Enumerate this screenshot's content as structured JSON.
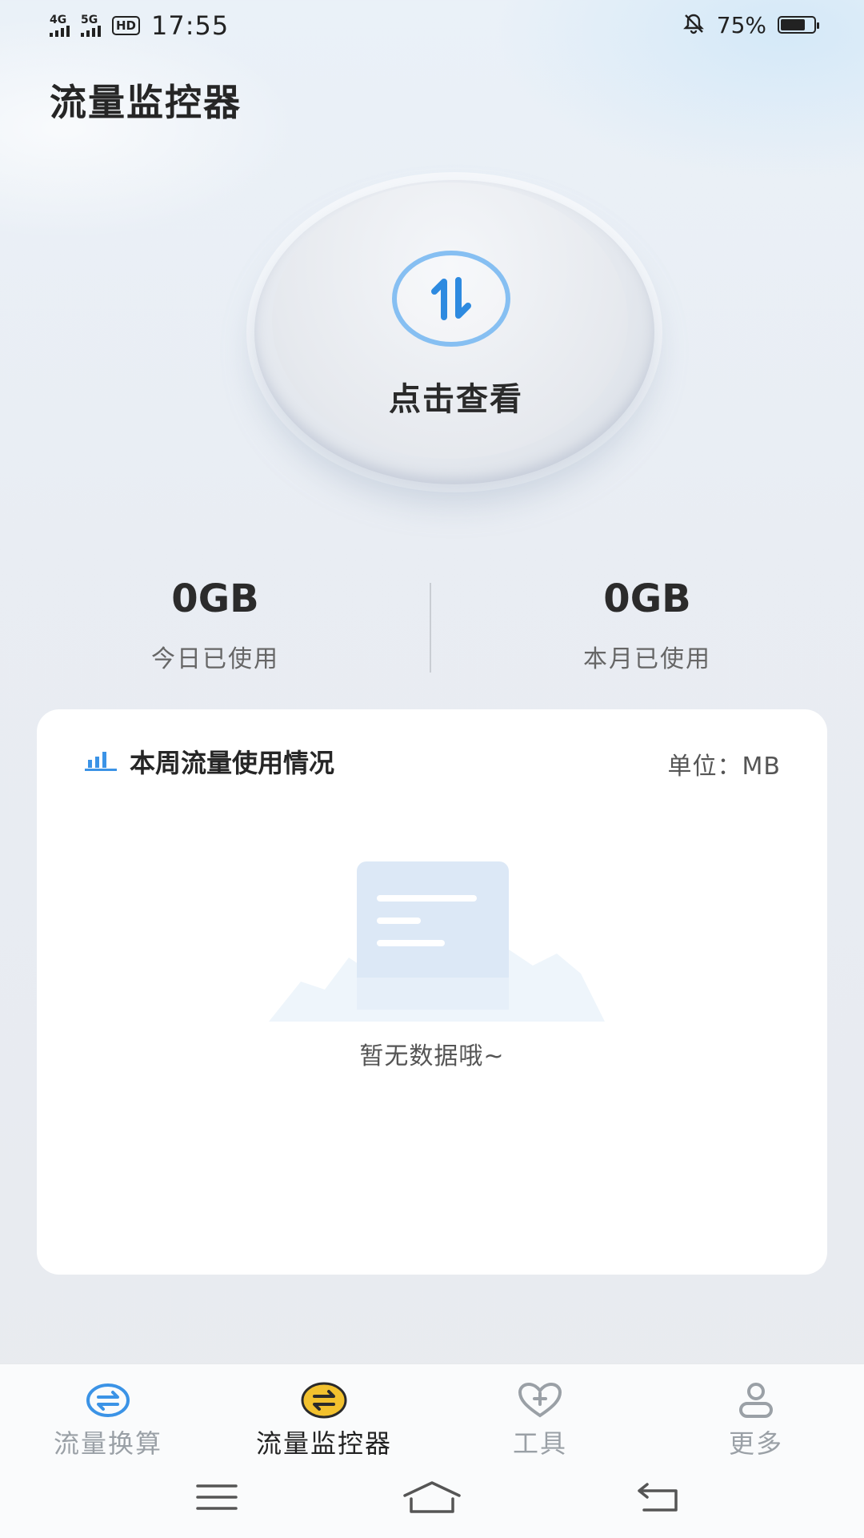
{
  "status_bar": {
    "net1": "4G",
    "net2": "5G",
    "hd": "HD",
    "time": "17:55",
    "battery_pct": "75%",
    "battery_level": 0.75
  },
  "app": {
    "title": "流量监控器"
  },
  "dial": {
    "label": "点击查看",
    "icon": "swap-arrows-icon"
  },
  "stats": {
    "today": {
      "value": "0GB",
      "label": "今日已使用"
    },
    "month": {
      "value": "0GB",
      "label": "本月已使用"
    }
  },
  "weekly_card": {
    "title": "本周流量使用情况",
    "unit": "单位：MB",
    "empty_text": "暂无数据哦~"
  },
  "nav": {
    "items": [
      {
        "label": "流量换算",
        "icon": "convert-icon",
        "active": false
      },
      {
        "label": "流量监控器",
        "icon": "monitor-icon",
        "active": true
      },
      {
        "label": "工具",
        "icon": "heart-plus-icon",
        "active": false
      },
      {
        "label": "更多",
        "icon": "user-icon",
        "active": false
      }
    ]
  },
  "colors": {
    "accent_blue": "#3b93e6",
    "accent_yellow": "#f2c12e",
    "inactive": "#9aa0a6"
  }
}
